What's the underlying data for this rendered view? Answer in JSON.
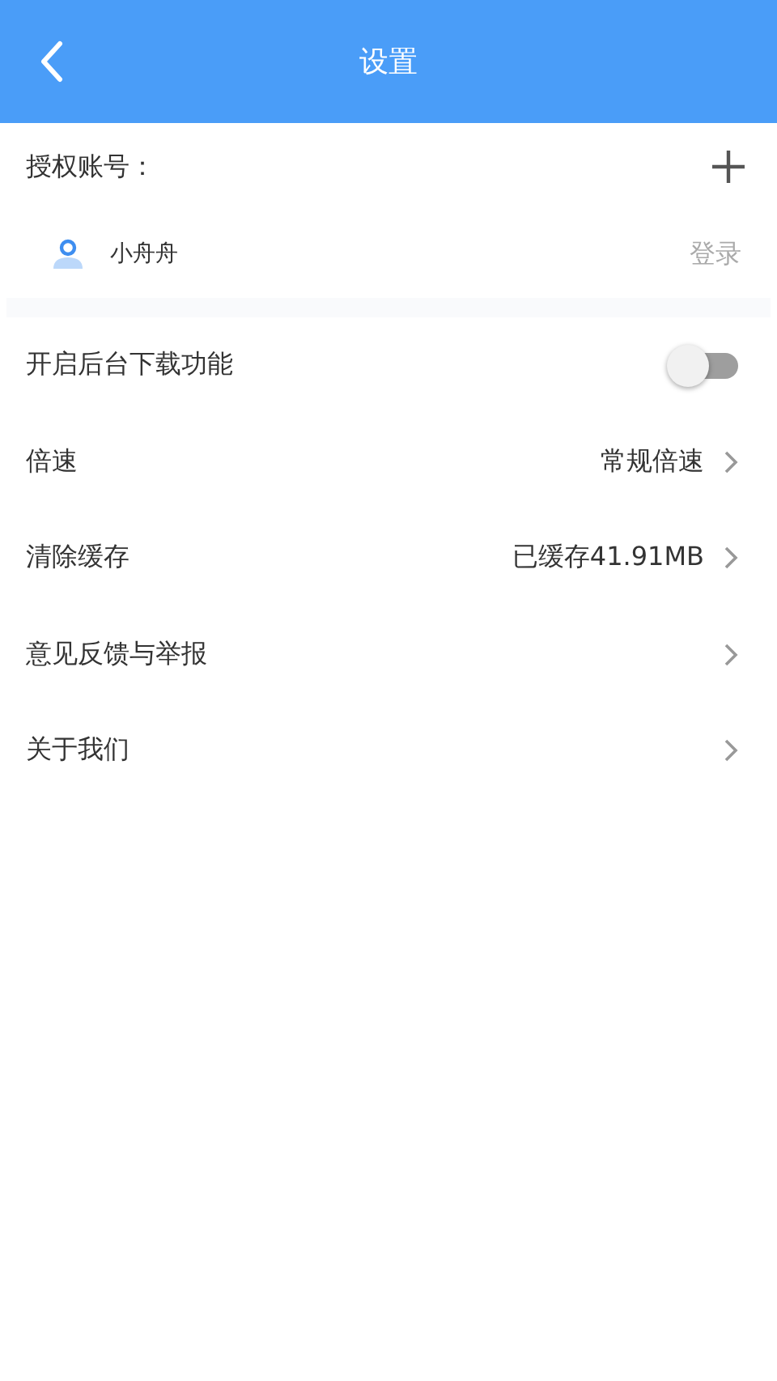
{
  "header": {
    "title": "设置"
  },
  "account": {
    "label": "授权账号：",
    "user": {
      "name": "小舟舟",
      "action": "登录"
    }
  },
  "settings": [
    {
      "kind": "toggle",
      "label": "开启后台下载功能",
      "on": false
    },
    {
      "kind": "link",
      "label": "倍速",
      "value": "常规倍速"
    },
    {
      "kind": "link",
      "label": "清除缓存",
      "value": "已缓存41.91MB"
    },
    {
      "kind": "link",
      "label": "意见反馈与举报"
    },
    {
      "kind": "link",
      "label": "关于我们"
    }
  ]
}
